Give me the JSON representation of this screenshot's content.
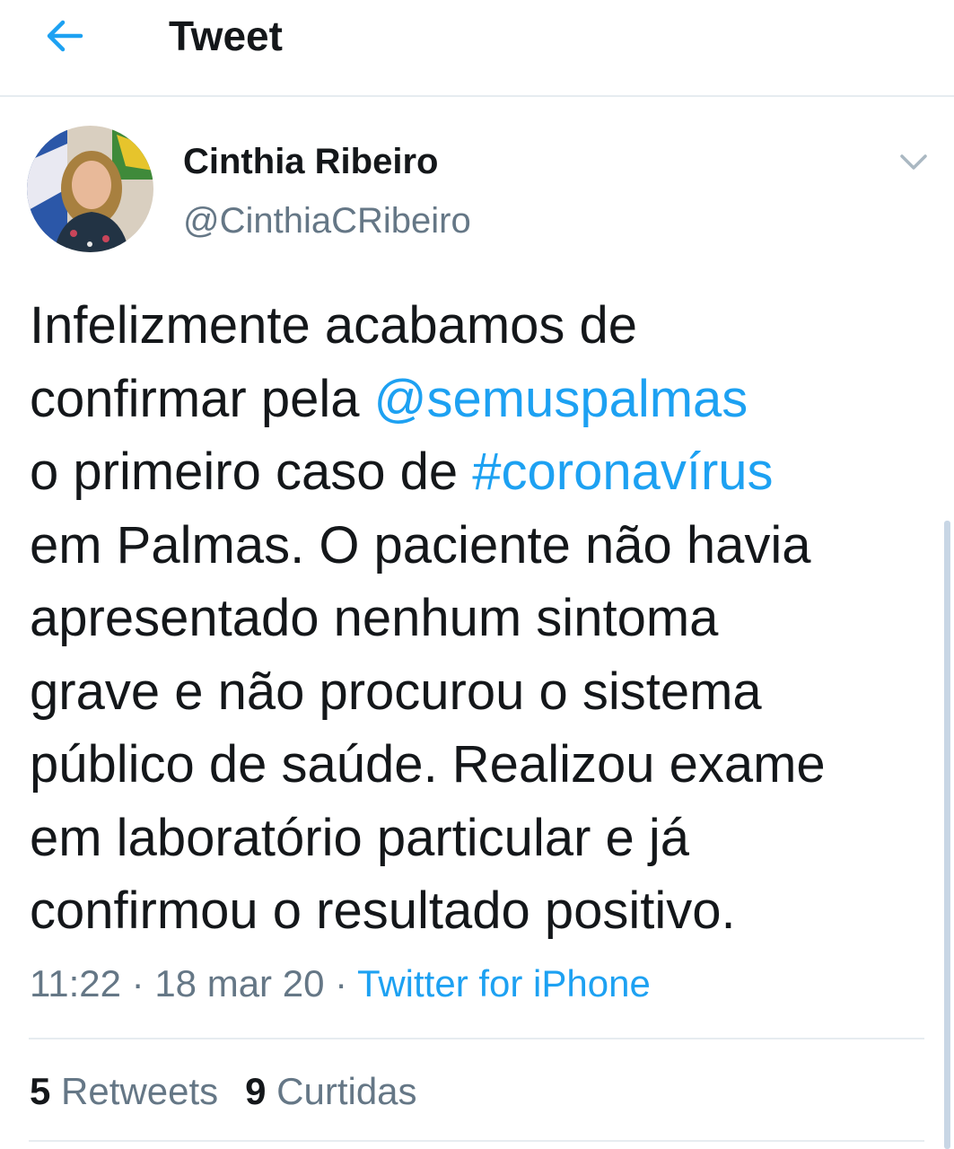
{
  "header": {
    "title": "Tweet",
    "back_icon": "arrow-left-icon"
  },
  "author": {
    "name": "Cinthia Ribeiro",
    "handle": "@CinthiaCRibeiro",
    "avatar": "user-avatar",
    "more_icon": "chevron-down-icon"
  },
  "tweet": {
    "lines": [
      {
        "pre": "Infelizmente acabamos de",
        "link": "",
        "post": ""
      },
      {
        "pre": "confirmar pela ",
        "link": "@semuspalmas",
        "post": ""
      },
      {
        "pre": "o primeiro caso de ",
        "link": "#coronavírus",
        "post": ""
      },
      {
        "pre": "em Palmas. O paciente não havia",
        "link": "",
        "post": ""
      },
      {
        "pre": "apresentado nenhum sintoma",
        "link": "",
        "post": ""
      },
      {
        "pre": "grave e não procurou o sistema",
        "link": "",
        "post": ""
      },
      {
        "pre": "público de saúde. Realizou exame",
        "link": "",
        "post": ""
      },
      {
        "pre": "em laboratório particular e já",
        "link": "",
        "post": ""
      },
      {
        "pre": "confirmou o resultado positivo.",
        "link": "",
        "post": ""
      }
    ]
  },
  "meta": {
    "time": "11:22",
    "separator": " · ",
    "date": "18 mar 20",
    "source": "Twitter for iPhone"
  },
  "stats": {
    "retweets_count": "5",
    "retweets_label": "Retweets",
    "likes_count": "9",
    "likes_label": "Curtidas"
  },
  "colors": {
    "accent": "#1da1f2",
    "text": "#14171a",
    "muted": "#657786",
    "divider": "#e6ecf0"
  }
}
